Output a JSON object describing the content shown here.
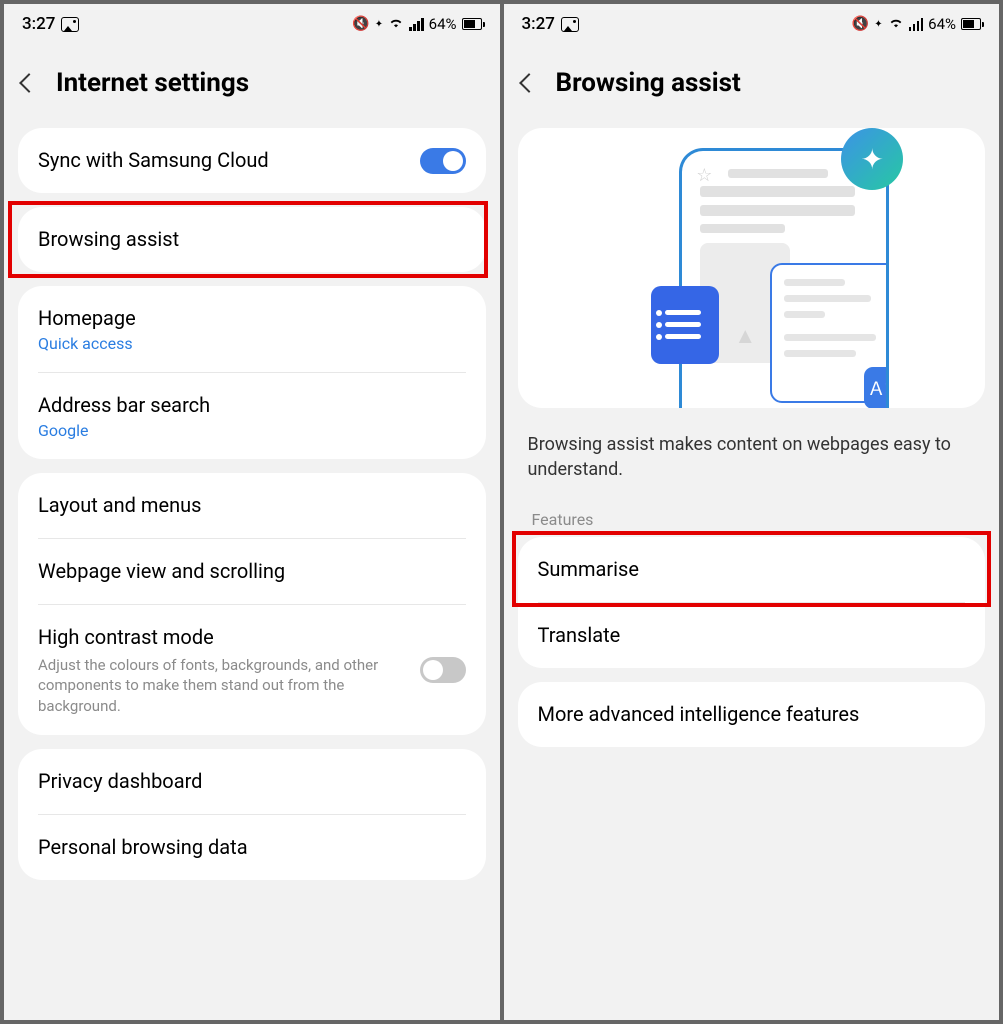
{
  "status": {
    "time": "3:27",
    "battery_pct": "64%"
  },
  "left": {
    "title": "Internet settings",
    "sync": {
      "label": "Sync with Samsung Cloud",
      "on": true
    },
    "browsing_assist": "Browsing assist",
    "homepage": {
      "label": "Homepage",
      "value": "Quick access"
    },
    "address_bar": {
      "label": "Address bar search",
      "value": "Google"
    },
    "layout": "Layout and menus",
    "webpage_view": "Webpage view and scrolling",
    "high_contrast": {
      "label": "High contrast mode",
      "desc": "Adjust the colours of fonts, backgrounds, and other components to make them stand out from the background.",
      "on": false
    },
    "privacy": "Privacy dashboard",
    "personal": "Personal browsing data"
  },
  "right": {
    "title": "Browsing assist",
    "description": "Browsing assist makes content on webpages easy to understand.",
    "features_label": "Features",
    "summarise": "Summarise",
    "translate": "Translate",
    "more": "More advanced intelligence features"
  }
}
